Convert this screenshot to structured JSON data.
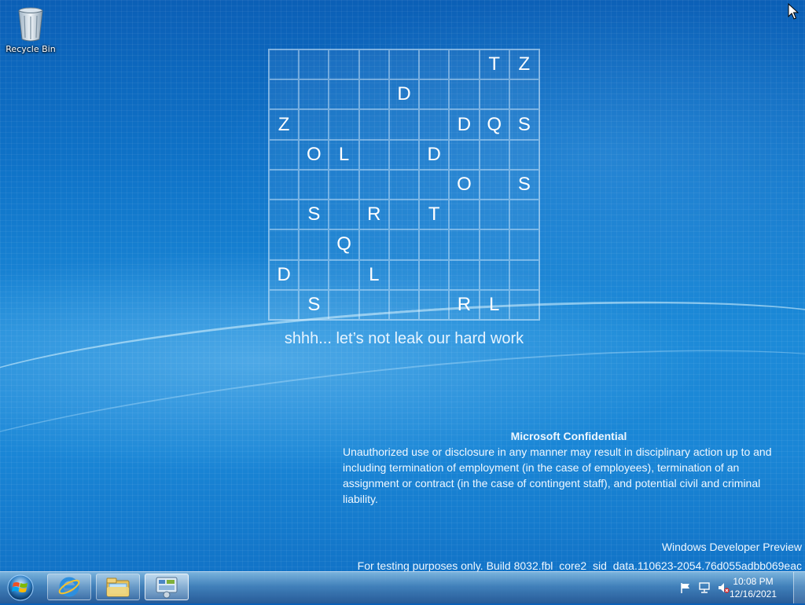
{
  "desktop": {
    "icons": [
      {
        "label": "Recycle Bin",
        "icon": "recycle-bin-icon"
      }
    ]
  },
  "puzzle": {
    "rows": [
      [
        "",
        "",
        "",
        "",
        "",
        "",
        "",
        "T",
        "Z"
      ],
      [
        "",
        "",
        "",
        "",
        "D",
        "",
        "",
        "",
        ""
      ],
      [
        "Z",
        "",
        "",
        "",
        "",
        "",
        "D",
        "Q",
        "S"
      ],
      [
        "",
        "O",
        "L",
        "",
        "",
        "D",
        "",
        "",
        ""
      ],
      [
        "",
        "",
        "",
        "",
        "",
        "",
        "O",
        "",
        "S"
      ],
      [
        "",
        "S",
        "",
        "R",
        "",
        "T",
        "",
        "",
        ""
      ],
      [
        "",
        "",
        "Q",
        "",
        "",
        "",
        "",
        "",
        ""
      ],
      [
        "D",
        "",
        "",
        "L",
        "",
        "",
        "",
        "",
        ""
      ],
      [
        "",
        "S",
        "",
        "",
        "",
        "",
        "R",
        "L",
        ""
      ]
    ],
    "tagline": "shhh... let’s not leak our hard work"
  },
  "confidential": {
    "title": "Microsoft Confidential",
    "body": "Unauthorized use or disclosure in any manner may result in disciplinary action up to and including termination of employment (in the case of employees), termination of an assignment or contract (in the case of contingent staff), and potential civil and criminal liability."
  },
  "watermark": {
    "product": "Windows Developer Preview",
    "build": "For testing purposes only. Build 8032.fbl_core2_sid_data.110623-2054.76d055adbb069eac"
  },
  "taskbar": {
    "start_icon": "windows-orb-icon",
    "pinned": [
      {
        "icon": "internet-explorer-icon"
      },
      {
        "icon": "windows-explorer-icon"
      },
      {
        "icon": "control-panel-icon",
        "active": true
      }
    ],
    "tray": {
      "icons": [
        "action-center-flag-icon",
        "network-icon",
        "volume-muted-icon"
      ],
      "time": "10:08 PM",
      "date": "12/16/2021"
    }
  }
}
